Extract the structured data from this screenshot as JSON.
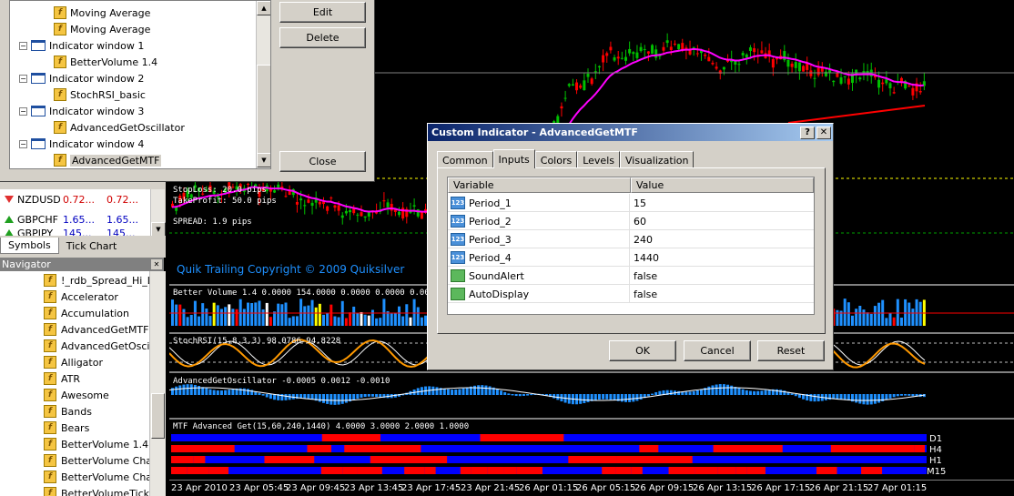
{
  "tree": {
    "items": [
      {
        "label": "Moving Average",
        "type": "indicator",
        "level": 2
      },
      {
        "label": "Moving Average",
        "type": "indicator",
        "level": 2
      },
      {
        "label": "Indicator window 1",
        "type": "window",
        "level": 1
      },
      {
        "label": "BetterVolume 1.4",
        "type": "indicator",
        "level": 2
      },
      {
        "label": "Indicator window 2",
        "type": "window",
        "level": 1
      },
      {
        "label": "StochRSI_basic",
        "type": "indicator",
        "level": 2
      },
      {
        "label": "Indicator window 3",
        "type": "window",
        "level": 1
      },
      {
        "label": "AdvancedGetOscillator",
        "type": "indicator",
        "level": 2
      },
      {
        "label": "Indicator window 4",
        "type": "window",
        "level": 1
      },
      {
        "label": "AdvancedGetMTF",
        "type": "indicator",
        "level": 2,
        "selected": true
      }
    ],
    "buttons": {
      "edit": "Edit",
      "delete": "Delete",
      "close": "Close"
    }
  },
  "market_watch": {
    "rows": [
      {
        "symbol": "NZDUSD",
        "bid": "0.72...",
        "ask": "0.72...",
        "dir": "down"
      },
      {
        "symbol": "GBPCHF",
        "bid": "1.65...",
        "ask": "1.65...",
        "dir": "up"
      },
      {
        "symbol": "GBPJPY",
        "bid": "145...",
        "ask": "145...",
        "dir": "up"
      }
    ],
    "tabs": [
      "Symbols",
      "Tick Chart"
    ]
  },
  "navigator": {
    "title": "Navigator",
    "items": [
      "!_rdb_Spread_Hi_Lo",
      "Accelerator",
      "Accumulation",
      "AdvancedGetMTF",
      "AdvancedGetOscilla",
      "Alligator",
      "ATR",
      "Awesome",
      "Bands",
      "Bears",
      "BetterVolume 1.4",
      "BetterVolume Chart",
      "BetterVolume Chart",
      "BetterVolumeTicks"
    ]
  },
  "chart": {
    "overlay": {
      "stoploss": "StopLoss: 20.0 pips",
      "takeprofit": "TakeProfit: 50.0 pips",
      "spread": "SPREAD: 1.9 pips",
      "quik": "Quik Trailing   Copyright © 2009  Quiksilver"
    },
    "sub_titles": {
      "volume": "Better Volume 1.4 0.0000 154.0000 0.0000 0.0000 0.0000 7",
      "stoch": "StochRSI(15,8,3,3) 98.0786 94.8228",
      "osc": "AdvancedGetOscillator -0.0005 0.0012 -0.0010",
      "mtf": "MTF Advanced Get(15,60,240,1440) 4.0000 3.0000 2.0000 1.0000"
    },
    "mtf_labels": [
      "D1",
      "H4",
      "H1",
      "M15"
    ],
    "x_ticks": [
      "23 Apr 2010",
      "23 Apr 05:45",
      "23 Apr 09:45",
      "23 Apr 13:45",
      "23 Apr 17:45",
      "23 Apr 21:45",
      "26 Apr 01:15",
      "26 Apr 05:15",
      "26 Apr 09:15",
      "26 Apr 13:15",
      "26 Apr 17:15",
      "26 Apr 21:15",
      "27 Apr 01:15"
    ],
    "colors": {
      "bull": "#00c000",
      "bear": "#ff0000",
      "ma_fast": "#ff00ff",
      "ma_slow": "#ff0000",
      "stoch": "#ff9900",
      "osc": "#1e90ff",
      "mtf_blue": "#0000ff",
      "mtf_red": "#ff0000"
    }
  },
  "dialog": {
    "title": "Custom Indicator - AdvancedGetMTF",
    "help": "?",
    "close": "✕",
    "tabs": [
      "Common",
      "Inputs",
      "Colors",
      "Levels",
      "Visualization"
    ],
    "active_tab": "Inputs",
    "columns": [
      "Variable",
      "Value"
    ],
    "rows": [
      {
        "variable": "Period_1",
        "value": "15",
        "type": "number"
      },
      {
        "variable": "Period_2",
        "value": "60",
        "type": "number"
      },
      {
        "variable": "Period_3",
        "value": "240",
        "type": "number"
      },
      {
        "variable": "Period_4",
        "value": "1440",
        "type": "number"
      },
      {
        "variable": "SoundAlert",
        "value": "false",
        "type": "bool"
      },
      {
        "variable": "AutoDisplay",
        "value": "false",
        "type": "bool"
      }
    ],
    "icon_number_text": "123",
    "buttons": {
      "ok": "OK",
      "cancel": "Cancel",
      "reset": "Reset"
    }
  }
}
